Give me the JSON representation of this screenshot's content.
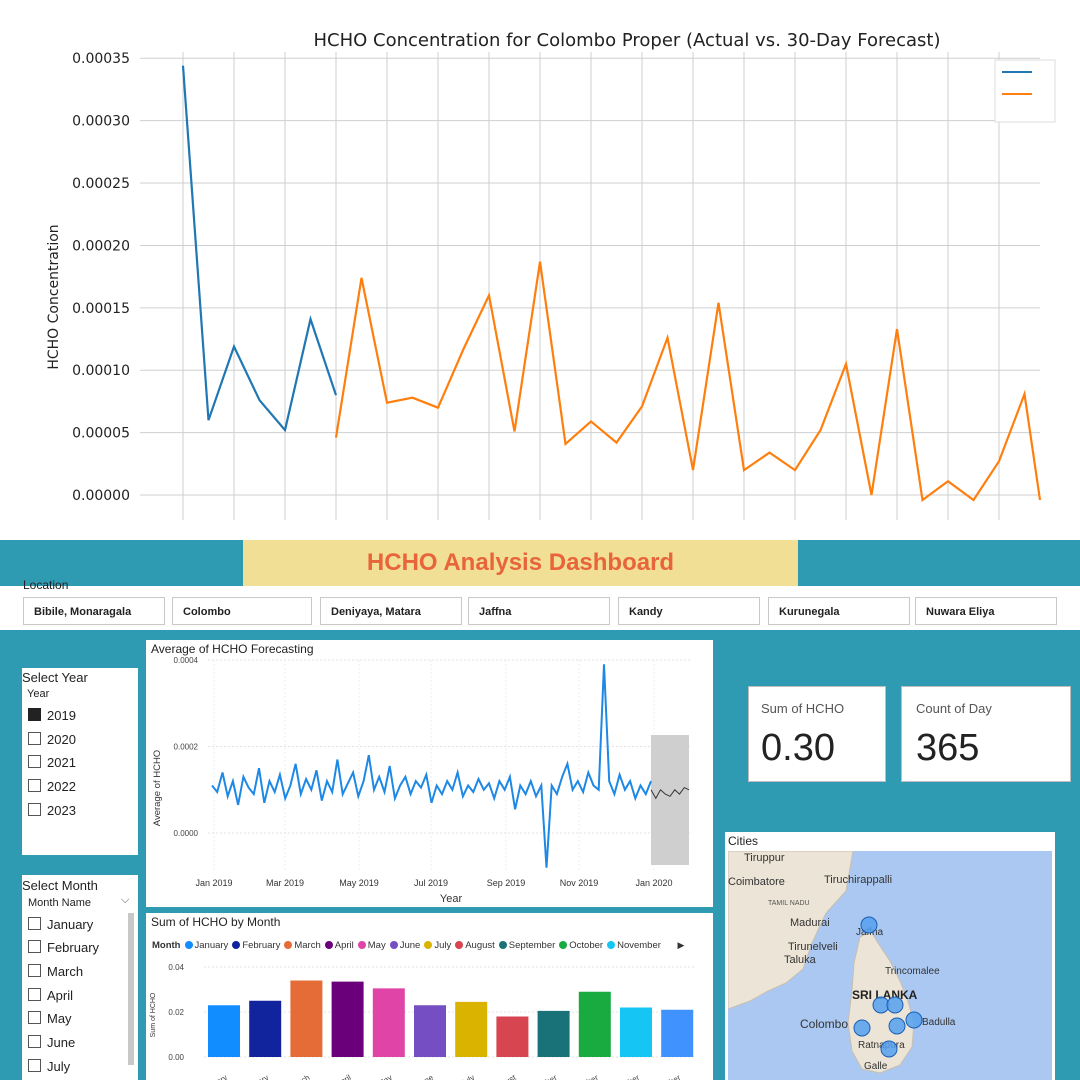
{
  "top_chart": {
    "title": "HCHO Concentration for Colombo Proper (Actual vs. 30-Day Forecast)",
    "ylabel": "HCHO Concentration",
    "yticks": [
      "0.00035",
      "0.00030",
      "0.00025",
      "0.00020",
      "0.00015",
      "0.00010",
      "0.00005",
      "0.00000"
    ]
  },
  "dashboard": {
    "title": "HCHO Analysis Dashboard",
    "location_label": "Location",
    "locations": [
      "Bibile, Monaragala",
      "Colombo",
      "Deniyaya, Matara",
      "Jaffna",
      "Kandy",
      "Kurunegala",
      "Nuwara Eliya"
    ],
    "year_slicer": {
      "title": "Select Year",
      "header": "Year",
      "items": [
        {
          "label": "2019",
          "checked": true
        },
        {
          "label": "2020",
          "checked": false
        },
        {
          "label": "2021",
          "checked": false
        },
        {
          "label": "2022",
          "checked": false
        },
        {
          "label": "2023",
          "checked": false
        }
      ]
    },
    "month_slicer": {
      "title": "Select Month",
      "header": "Month Name",
      "items": [
        "January",
        "February",
        "March",
        "April",
        "May",
        "June",
        "July"
      ]
    },
    "forecast_chart": {
      "title": "Average of HCHO Forecasting",
      "ylabel": "Average of HCHO",
      "xlabel": "Year",
      "yticks": [
        "0.0004",
        "0.0002",
        "0.0000"
      ],
      "xticks": [
        "Jan 2019",
        "Mar 2019",
        "May 2019",
        "Jul 2019",
        "Sep 2019",
        "Nov 2019",
        "Jan 2020"
      ]
    },
    "cards": {
      "sum_label": "Sum of HCHO",
      "sum_value": "0.30",
      "count_label": "Count of Day",
      "count_value": "365"
    },
    "month_chart": {
      "title": "Sum of HCHO by Month",
      "legend_title": "Month",
      "ylabel": "Sum of HCHO",
      "yticks": [
        "0.04",
        "0.02",
        "0.00"
      ]
    },
    "map": {
      "title": "Cities",
      "labels": [
        "Tiruppur",
        "Coimbatore",
        "Tiruchirappalli",
        "TAMIL NADU",
        "Madurai",
        "Jaffna",
        "Tirunelveli",
        "Taluka",
        "Trincomalee",
        "SRI LANKA",
        "Colombo",
        "Badulla",
        "Ratnapura",
        "Galle"
      ]
    }
  },
  "chart_data": [
    {
      "type": "line",
      "title": "HCHO Concentration for Colombo Proper (Actual vs. 30-Day Forecast)",
      "ylabel": "HCHO Concentration",
      "ylim": [
        -2e-05,
        0.000355
      ],
      "grid": true,
      "legend": "top-right",
      "series": [
        {
          "color": "#1f77b4",
          "values": [
            0.000344,
            6e-05,
            0.000119,
            7.6e-05,
            5.2e-05,
            0.000141,
            8e-05
          ]
        },
        {
          "color": "#ff7f0e",
          "values": [
            4.6e-05,
            0.000174,
            7.4e-05,
            7.8e-05,
            7e-05,
            0.000117,
            0.00016,
            5.1e-05,
            0.000187,
            4.1e-05,
            5.9e-05,
            4.2e-05,
            7.1e-05,
            0.000126,
            2e-05,
            0.000154,
            2e-05,
            3.4e-05,
            2e-05,
            5.2e-05,
            0.000105,
            0.0,
            0.000133,
            -4e-06,
            1.1e-05,
            -4e-06,
            2.7e-05,
            8.1e-05,
            -4e-06
          ]
        }
      ]
    },
    {
      "type": "line",
      "title": "Average of HCHO Forecasting",
      "xlabel": "Year",
      "ylabel": "Average of HCHO",
      "ylim": [
        -9e-05,
        0.0004
      ],
      "series": [
        {
          "color": "#1e88e5",
          "values": [
            0.00011,
            9.5e-05,
            0.00014,
            8.5e-05,
            0.00012,
            6.5e-05,
            0.00013,
            0.000105,
            9e-05,
            0.00015,
            7e-05,
            0.00012,
            9.5e-05,
            0.000135,
            8e-05,
            0.00011,
            0.00016,
            9e-05,
            0.000125,
            0.0001,
            0.000145,
            7.5e-05,
            0.00012,
            9.5e-05,
            0.00017,
            9e-05,
            0.000115,
            0.00014,
            8.5e-05,
            0.00012,
            0.00018,
            0.0001,
            0.00013,
            9.5e-05,
            0.000155,
            8e-05,
            0.00011,
            0.00013,
            9e-05,
            0.00012,
            0.000105,
            0.000135,
            7e-05,
            0.00011,
            9e-05,
            0.00012,
            0.0001,
            0.00014,
            8.5e-05,
            0.00011,
            9.5e-05,
            0.000125,
            0.0001,
            0.000115,
            8e-05,
            0.00012,
            0.0001,
            0.00013,
            5.5e-05,
            0.00011,
            9e-05,
            0.00012,
            8.5e-05,
            0.00011,
            -8e-05,
            0.00011,
            9e-05,
            0.00013,
            0.00016,
            0.0001,
            0.00012,
            9.5e-05,
            0.00014,
            0.00011,
            0.0001,
            0.00039,
            0.00012,
            9e-05,
            0.000135,
            0.0001,
            0.00012,
            8e-05,
            0.00011,
            9e-05,
            0.00012
          ]
        },
        {
          "color": "#333333",
          "name": "",
          "values": [
            0.0001,
            8e-05,
            0.0001,
            9e-05,
            8.5e-05,
            0.0001,
            9e-05,
            0.000105,
            0.0001
          ]
        }
      ]
    },
    {
      "type": "bar",
      "title": "Sum of HCHO by Month",
      "ylabel": "Sum of HCHO",
      "ylim": [
        0,
        0.04
      ],
      "categories": [
        "January",
        "February",
        "March",
        "April",
        "May",
        "June",
        "July",
        "August",
        "September",
        "October",
        "November",
        "December"
      ],
      "values": [
        0.023,
        0.025,
        0.034,
        0.0335,
        0.0305,
        0.023,
        0.0245,
        0.018,
        0.0205,
        0.029,
        0.022,
        0.021
      ],
      "colors": [
        "#118dff",
        "#12239e",
        "#e66c37",
        "#6b007b",
        "#e044a7",
        "#744ec2",
        "#d9b300",
        "#d64550",
        "#197278",
        "#1aab40",
        "#15c6f4",
        "#4092ff"
      ],
      "legend_entries": [
        "January",
        "February",
        "March",
        "April",
        "May",
        "June",
        "July",
        "August",
        "September",
        "October",
        "November"
      ]
    }
  ]
}
